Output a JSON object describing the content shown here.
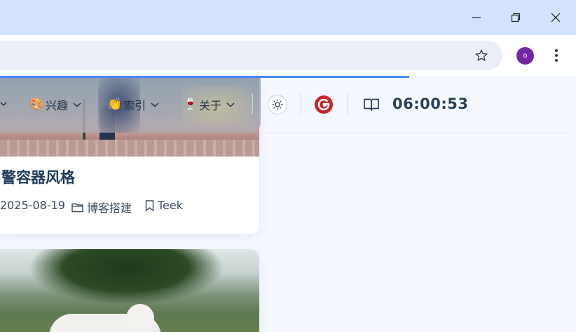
{
  "browser": {
    "profile_initial": "o",
    "icons": {
      "minimize": "minimize-icon",
      "restore": "restore-icon",
      "close": "close-icon",
      "bookmark": "star-icon",
      "menu": "kebab-menu-icon"
    },
    "colors": {
      "titlebar": "#d3e3fd",
      "progress": "#4c87f6",
      "profile": "#7527a3"
    },
    "load_progress_percent": 71
  },
  "nav": {
    "items": [
      {
        "emoji": "🎨",
        "label": "兴趣"
      },
      {
        "emoji": "👏",
        "label": "索引"
      },
      {
        "emoji": "🍷",
        "label": "关于"
      }
    ],
    "clock": "06:00:53",
    "icons": {
      "theme": "sun-icon",
      "g_logo": "g-logo-icon",
      "read_mode": "book-icon"
    }
  },
  "posts": [
    {
      "title": "警容器风格",
      "date": "2025-08-19",
      "category": "博客搭建",
      "tag": "Teek"
    },
    {
      "title": "",
      "image": "goat-under-tree"
    }
  ]
}
